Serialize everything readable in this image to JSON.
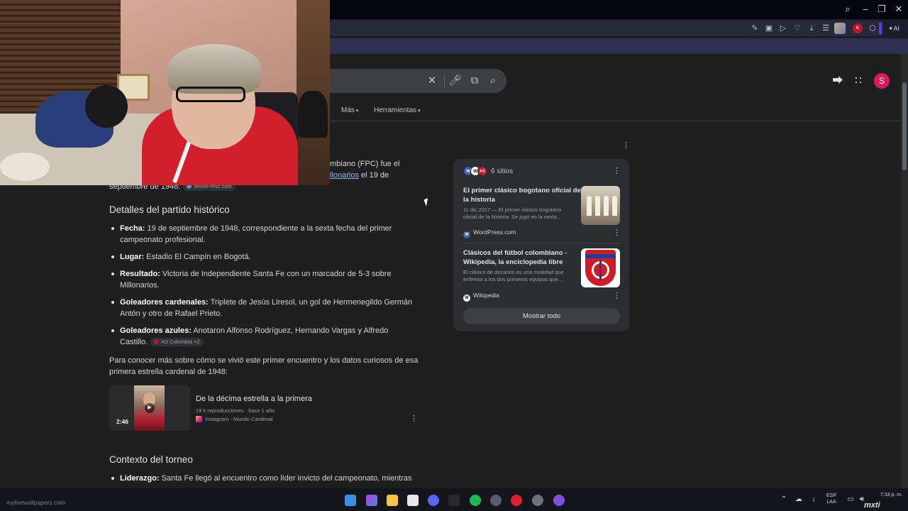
{
  "browser": {
    "ai_label": "AI",
    "ext_badge_label": "K"
  },
  "search": {
    "query": "",
    "clear_icon": "close-icon",
    "voice_icon": "mic-icon",
    "lens_icon": "lens-icon",
    "search_icon": "search-icon"
  },
  "header": {
    "user_initial": "S",
    "share_icon": "share-icon",
    "apps_icon": "apps-grid-icon"
  },
  "filters": {
    "more": "Más",
    "tools": "Herramientas"
  },
  "answer": {
    "intro_line1": "mbiano (FPC) fue el",
    "intro_line2_link": "llonarios",
    "intro_line2_rest": " el 19 de",
    "intro_line3": "septiembre de 1948.",
    "intro_chip": "WordPress.com",
    "section1_title": "Detalles del partido histórico",
    "bullets": [
      {
        "label": "Fecha:",
        "text": " 19 de septiembre de 1948, correspondiente a la sexta fecha del primer",
        "text2": "campeonato profesional."
      },
      {
        "label": "Lugar:",
        "text": " Estadio El Campín en Bogotá.",
        "text2": ""
      },
      {
        "label": "Resultado:",
        "text": " Victoria de Independiente Santa Fe con un marcador de 5-3 sobre",
        "text2": "Millonarios."
      },
      {
        "label": "Goleadores cardenales:",
        "text": " Triplete de Jesús Liresol, un gol de Hermenegildo Germán",
        "text2": "Antón y otro de Rafael Prieto."
      },
      {
        "label": "Goleadores azules:",
        "text": " Anotaron Alfonso Rodríguez, Hernando Vargas y Alfredo",
        "text2": "Castillo."
      }
    ],
    "bullets_chip": "AS Colombia +2",
    "follow_line1": "Para conocer más sobre cómo se vivió este primer encuentro y los datos curiosos de esa",
    "follow_line2": "primera estrella cardenal de 1948:",
    "video": {
      "duration": "2:46",
      "title": "De la décima estrella a la primera",
      "meta": "19 k reproducciones · hace 1 año",
      "source": "Instagram · Mundo Cardenal"
    },
    "section2_title": "Contexto del torneo",
    "context_label": "Liderazgo:",
    "context_text": " Santa Fe llegó al encuentro como líder invicto del campeonato, mientras"
  },
  "sources": {
    "count": "6 sitios",
    "logo_labels": [
      "W",
      "W",
      "AS"
    ],
    "items": [
      {
        "title1": "El primer clásico bogotano oficial de",
        "title2": "la historia",
        "snip1": "11 dic 2017 — El primer clásico bogotano",
        "snip2": "oficial de la historia. Se jugó en la sexta...",
        "site": "WordPress.com",
        "site_initial": "W"
      },
      {
        "title1": "Clásicos del fútbol colombiano -",
        "title2": "Wikipedia, la enciclopedia libre",
        "snip1": "El clásico de decanos es una rivalidad que",
        "snip2": "enfrenta a los dos primeros equipos que...",
        "site": "Wikipedia",
        "site_initial": "W"
      }
    ],
    "show_all": "Mostrar todo"
  },
  "taskbar": {
    "watermark": "mylivewallpapers.com",
    "lang_top": "ESP",
    "lang_bottom": "LAA",
    "time": "7:33 p. m.",
    "badge": "mxti"
  },
  "colors": {
    "accent_link": "#8ab4f8",
    "avatar_pink": "#d81b60",
    "page_bg": "#1f1f1f",
    "panel_bg": "#2b2d31"
  }
}
